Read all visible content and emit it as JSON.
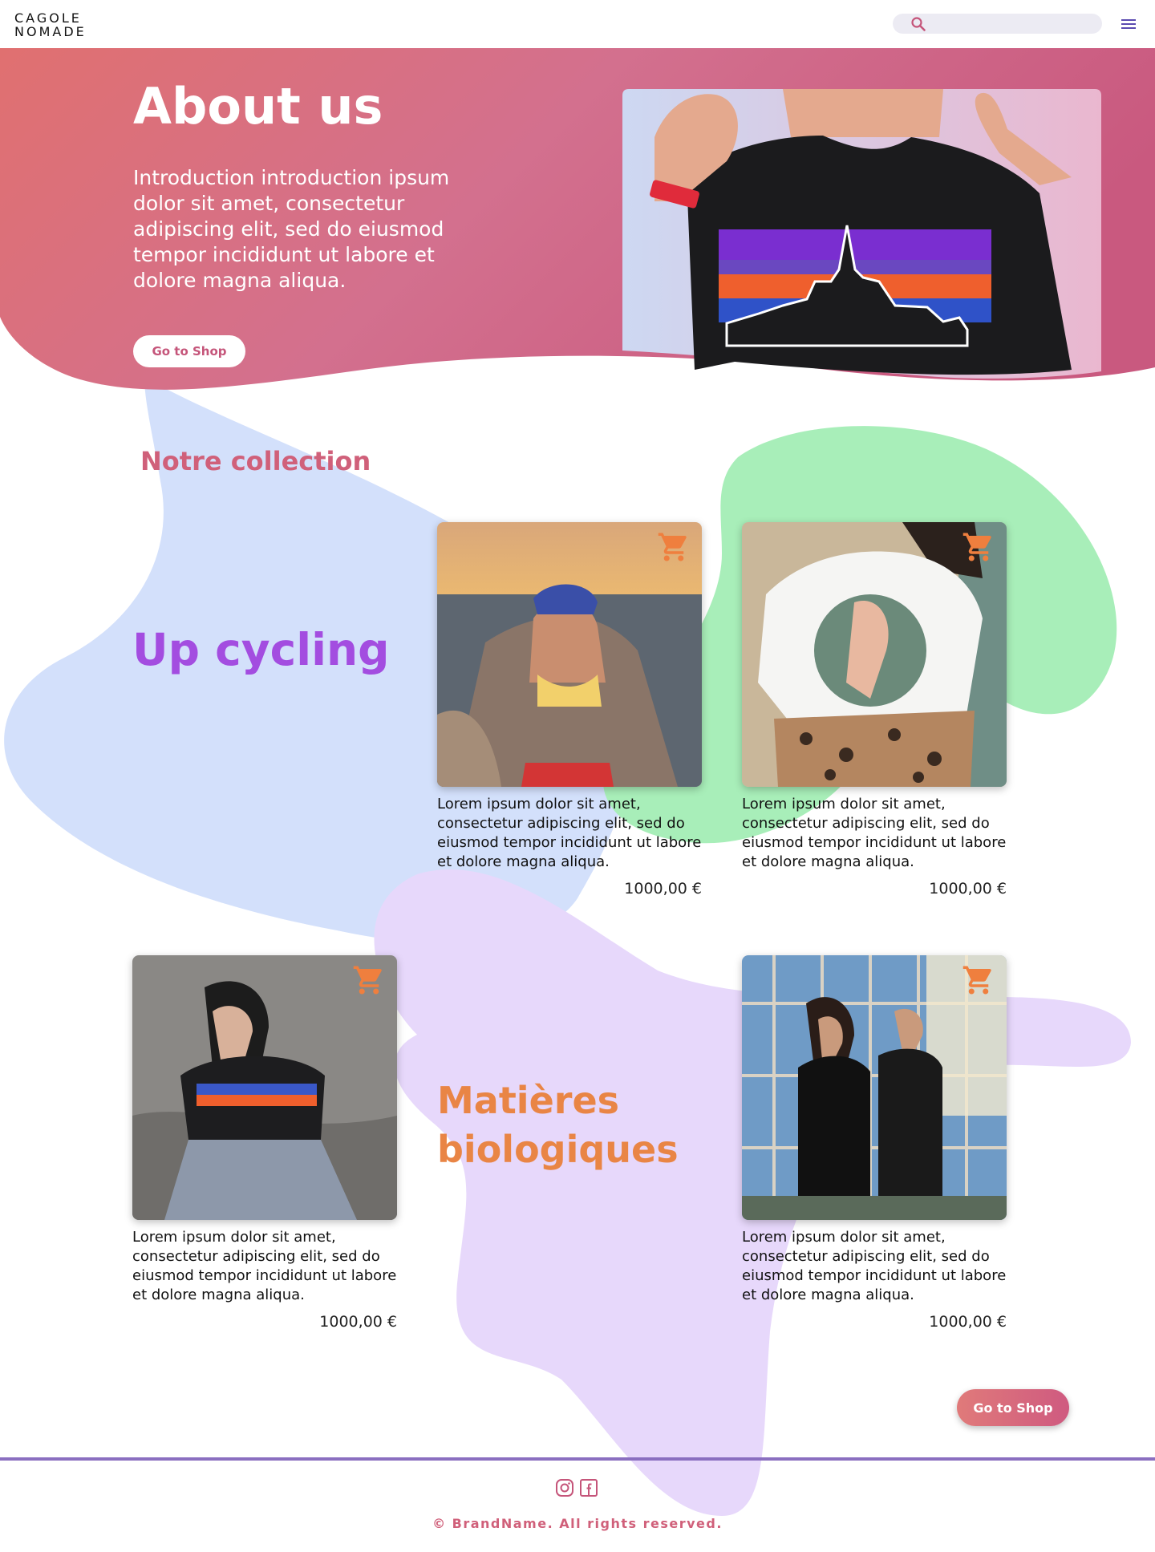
{
  "header": {
    "logo_line1": "CAGOLE",
    "logo_line2": "NOMADE",
    "search_placeholder": "",
    "search_icon": "search-icon",
    "menu_icon": "hamburger-menu-icon"
  },
  "hero": {
    "title": "About us",
    "intro": "Introduction introduction ipsum dolor sit amet, consectetur adipiscing elit, sed do eiusmod tempor incididunt ut labore et dolore magna aliqua.",
    "button_label": "Go to Shop"
  },
  "collection": {
    "title": "Notre collection",
    "label_upcycling": "Up cycling",
    "label_bio_line1": "Matières",
    "label_bio_line2": "biologiques",
    "products": [
      {
        "desc": "Lorem ipsum dolor sit amet, consectetur adipiscing elit, sed do eiusmod tempor incididunt ut labore et dolore magna aliqua.",
        "price": "1000,00 €"
      },
      {
        "desc": "Lorem ipsum dolor sit amet, consectetur adipiscing elit, sed do eiusmod tempor incididunt ut labore et dolore magna aliqua.",
        "price": "1000,00 €"
      },
      {
        "desc": "Lorem ipsum dolor sit amet, consectetur adipiscing elit, sed do eiusmod tempor incididunt ut labore et dolore magna aliqua.",
        "price": "1000,00 €"
      },
      {
        "desc": "Lorem ipsum dolor sit amet, consectetur adipiscing elit, sed do eiusmod tempor incididunt ut labore et dolore magna aliqua.",
        "price": "1000,00 €"
      }
    ],
    "cart_icon": "shopping-cart-icon",
    "shop_button_label": "Go to Shop"
  },
  "footer": {
    "icons": [
      "instagram-icon",
      "facebook-icon"
    ],
    "copyright": "© BrandName. All rights reserved."
  },
  "colors": {
    "hero_gradient_start": "#e07070",
    "hero_gradient_end": "#c9597f",
    "blob_blue": "#d3e0fb",
    "blob_green": "#a8eeb9",
    "blob_purple": "#e7d8fb",
    "accent_pink": "#d0607a",
    "accent_purple": "#a34de0",
    "accent_orange": "#e98545",
    "footer_line": "#8a6fc0"
  }
}
